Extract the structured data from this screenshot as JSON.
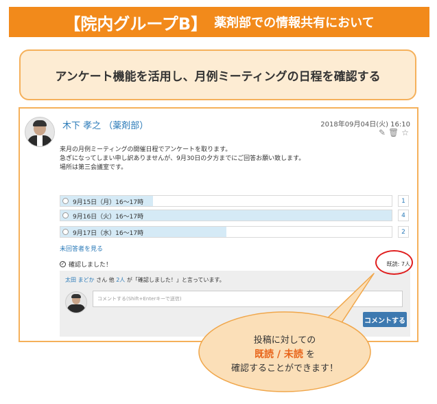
{
  "banner": {
    "title_main": "【院内グループB】",
    "title_sub": "薬剤部での情報共有において"
  },
  "subtitle": "アンケート機能を活用し、月例ミーティングの日程を確認する",
  "post": {
    "author": "木下 孝之 （薬剤部）",
    "date": "2018年09月04日(火) 16:10",
    "body": [
      "来月の月例ミーティングの開催日程でアンケートを取ります。",
      "急ぎになってしまい申し訳ありませんが、9月30日の夕方までにご回答お願い致します。",
      "場所は第三会議室です。"
    ],
    "options": [
      {
        "label": "9月15日（月）16～17時",
        "count": "1",
        "ratio": 0.28
      },
      {
        "label": "9月16日（火）16～17時",
        "count": "4",
        "ratio": 1.0
      },
      {
        "label": "9月17日（水）16～17時",
        "count": "2",
        "ratio": 0.5
      }
    ],
    "unanswered_link": "未回答者を見る",
    "confirm_label": "確認しました！",
    "read_count": "既読: 7人",
    "comment": {
      "summary_name": "太田 まどか",
      "summary_mid": " さん 他 ",
      "summary_count": "2人",
      "summary_tail": " が「確認しました！」と言っています。",
      "placeholder": "コメントする(Shift+Enterキーで送信)",
      "button_label": "コメントする"
    }
  },
  "callout": {
    "line1": "投稿に対しての",
    "highlight": "既読 / 未読",
    "line2_tail": " を",
    "line3": "確認することができます！"
  },
  "colors": {
    "banner": "#f28a1b",
    "accent_blue": "#2a7ab8",
    "highlight_orange": "#e8661c",
    "red_circle": "#e01f1f"
  }
}
